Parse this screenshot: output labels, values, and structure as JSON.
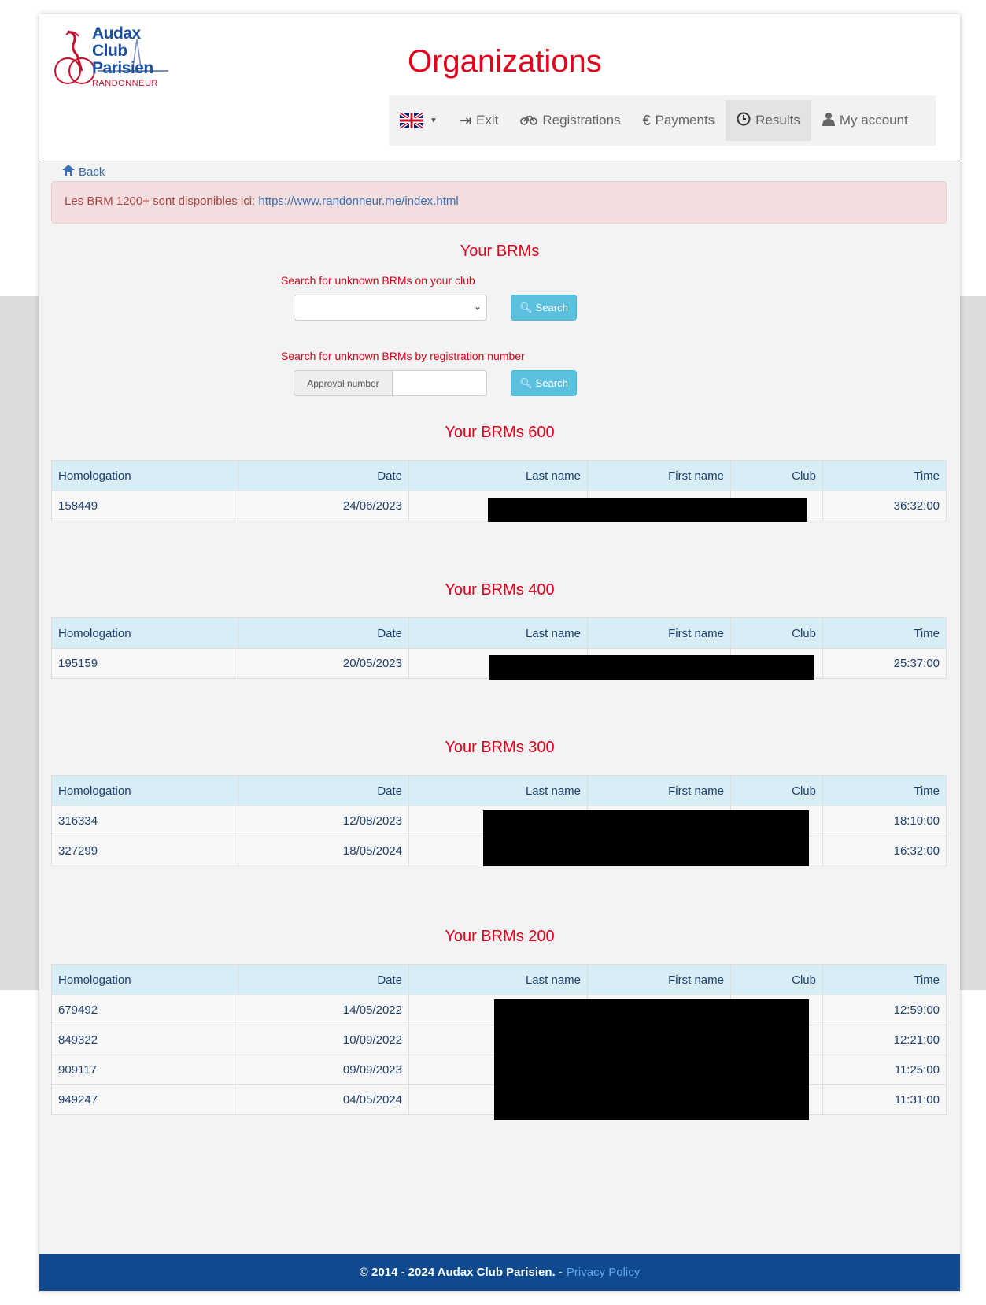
{
  "logo": {
    "line1": "Audax",
    "line2": "Club",
    "line3": "Parisien",
    "sub": "RANDONNEUR"
  },
  "page_title": "Organizations",
  "nav": {
    "exit": "Exit",
    "registrations": "Registrations",
    "payments": "Payments",
    "results": "Results",
    "account": "My account"
  },
  "back_label": "Back",
  "alert": {
    "text": "Les BRM 1200+ sont disponibles ici: ",
    "link": "https://www.randonneur.me/index.html"
  },
  "search": {
    "title": "Your BRMs",
    "club_label": "Search for unknown BRMs on your club",
    "reg_label": "Search for unknown BRMs by registration number",
    "addon": "Approval number",
    "button": "Search"
  },
  "columns": [
    "Homologation",
    "Date",
    "Last name",
    "First name",
    "Club",
    "Time"
  ],
  "sections": [
    {
      "title": "Your BRMs 600",
      "rows": [
        {
          "hom": "158449",
          "date": "24/06/2023",
          "time": "36:32:00"
        }
      ]
    },
    {
      "title": "Your BRMs 400",
      "rows": [
        {
          "hom": "195159",
          "date": "20/05/2023",
          "time": "25:37:00"
        }
      ]
    },
    {
      "title": "Your BRMs 300",
      "rows": [
        {
          "hom": "316334",
          "date": "12/08/2023",
          "time": "18:10:00"
        },
        {
          "hom": "327299",
          "date": "18/05/2024",
          "time": "16:32:00"
        }
      ]
    },
    {
      "title": "Your BRMs 200",
      "rows": [
        {
          "hom": "679492",
          "date": "14/05/2022",
          "time": "12:59:00"
        },
        {
          "hom": "849322",
          "date": "10/09/2022",
          "time": "12:21:00"
        },
        {
          "hom": "909117",
          "date": "09/09/2023",
          "time": "11:25:00"
        },
        {
          "hom": "949247",
          "date": "04/05/2024",
          "time": "11:31:00"
        }
      ]
    }
  ],
  "footer": {
    "text": "© 2014 - 2024 Audax Club Parisien. -",
    "link": "Privacy Policy"
  }
}
